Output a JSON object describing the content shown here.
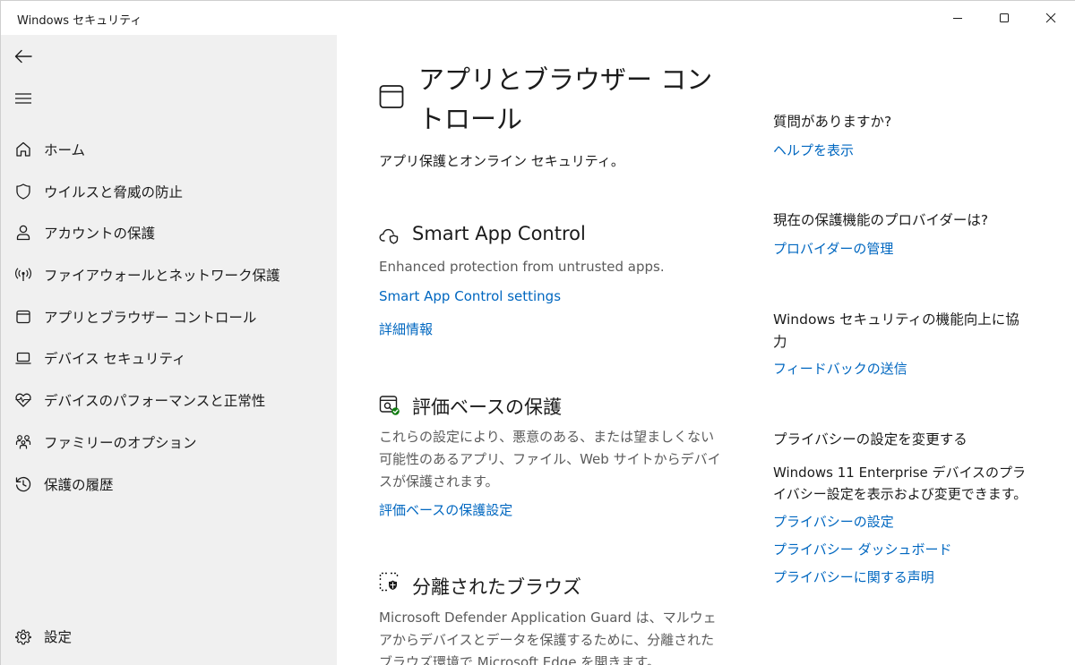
{
  "window": {
    "title": "Windows セキュリティ"
  },
  "sidebar": {
    "items": [
      {
        "label": "ホーム",
        "icon": "home-icon"
      },
      {
        "label": "ウイルスと脅威の防止",
        "icon": "shield-icon"
      },
      {
        "label": "アカウントの保護",
        "icon": "person-icon"
      },
      {
        "label": "ファイアウォールとネットワーク保護",
        "icon": "antenna-icon"
      },
      {
        "label": "アプリとブラウザー コントロール",
        "icon": "app-window-icon",
        "active": true
      },
      {
        "label": "デバイス セキュリティ",
        "icon": "laptop-icon"
      },
      {
        "label": "デバイスのパフォーマンスと正常性",
        "icon": "heart-pulse-icon"
      },
      {
        "label": "ファミリーのオプション",
        "icon": "family-icon"
      },
      {
        "label": "保護の履歴",
        "icon": "history-icon"
      }
    ],
    "settings_label": "設定"
  },
  "main": {
    "title": "アプリとブラウザー コントロール",
    "subtitle": "アプリ保護とオンライン セキュリティ。",
    "sections": {
      "smart_app": {
        "title": "Smart App Control",
        "text": "Enhanced protection from untrusted apps.",
        "link1": "Smart App Control settings",
        "link2": "詳細情報"
      },
      "reputation": {
        "title": "評価ベースの保護",
        "text": "これらの設定により、悪意のある、または望ましくない可能性のあるアプリ、ファイル、Web サイトからデバイスが保護されます。",
        "link": "評価ベースの保護設定"
      },
      "isolated": {
        "title": "分離されたブラウズ",
        "text": "Microsoft Defender Application Guard は、マルウェアからデバイスとデータを保護するために、分離されたブラウズ環境で Microsoft Edge を開きます。"
      }
    }
  },
  "aside": {
    "question": {
      "heading": "質問がありますか?",
      "link": "ヘルプを表示"
    },
    "provider": {
      "heading": "現在の保護機能のプロバイダーは?",
      "link": "プロバイダーの管理"
    },
    "improve": {
      "heading": "Windows セキュリティの機能向上に協力",
      "link": "フィードバックの送信"
    },
    "privacy": {
      "heading": "プライバシーの設定を変更する",
      "text": "Windows 11 Enterprise デバイスのプライバシー設定を表示および変更できます。",
      "link1": "プライバシーの設定",
      "link2": "プライバシー ダッシュボード",
      "link3": "プライバシーに関する声明"
    }
  },
  "colors": {
    "accent": "#0067c0",
    "sidebar_bg": "#f0f0f0",
    "text": "#1b1b1b",
    "muted_text": "#5b5b5b"
  }
}
